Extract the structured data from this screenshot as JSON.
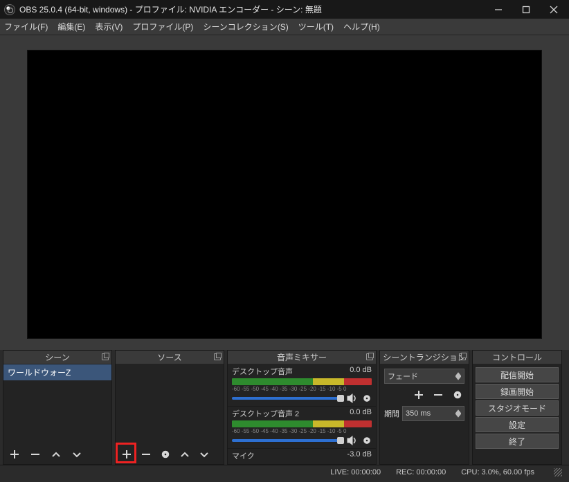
{
  "titlebar": {
    "title": "OBS 25.0.4 (64-bit, windows) - プロファイル: NVIDIA エンコーダー - シーン: 無題"
  },
  "menu": {
    "file": "ファイル(F)",
    "edit": "編集(E)",
    "view": "表示(V)",
    "profile": "プロファイル(P)",
    "scene_collection": "シーンコレクション(S)",
    "tools": "ツール(T)",
    "help": "ヘルプ(H)"
  },
  "panels": {
    "scenes_title": "シーン",
    "sources_title": "ソース",
    "mixer_title": "音声ミキサー",
    "transitions_title": "シーントランジション",
    "controls_title": "コントロール"
  },
  "scenes": {
    "items": [
      "ワールドウォーZ"
    ]
  },
  "mixer": {
    "tracks": [
      {
        "name": "デスクトップ音声",
        "db": "0.0 dB"
      },
      {
        "name": "デスクトップ音声 2",
        "db": "0.0 dB"
      },
      {
        "name": "マイク",
        "db": "-3.0 dB"
      }
    ],
    "ticks": "-60  -55  -50  -45  -40  -35  -30  -25  -20  -15  -10  -5   0"
  },
  "transitions": {
    "type": "フェード",
    "duration_label": "期間",
    "duration_value": "350 ms"
  },
  "controls": {
    "stream": "配信開始",
    "record": "録画開始",
    "studio": "スタジオモード",
    "settings": "設定",
    "exit": "終了"
  },
  "status": {
    "live": "LIVE: 00:00:00",
    "rec": "REC: 00:00:00",
    "cpu": "CPU: 3.0%, 60.00 fps"
  }
}
